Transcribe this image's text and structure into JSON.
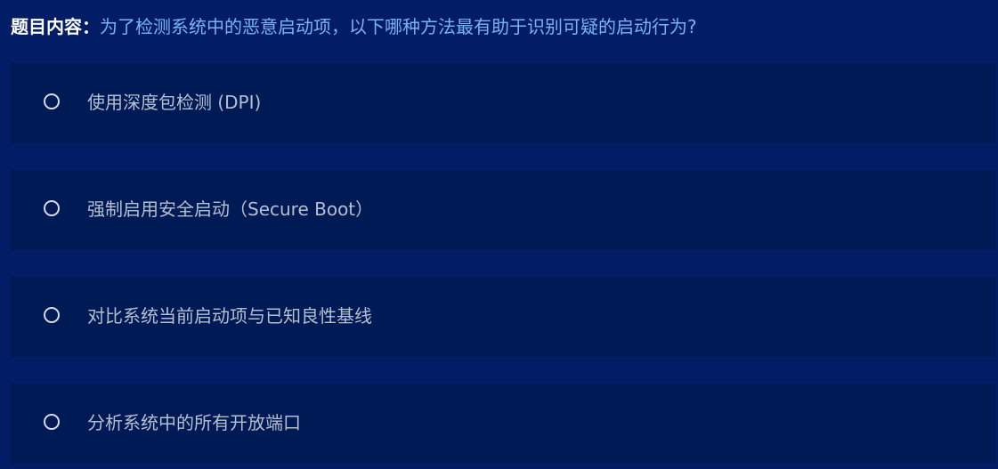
{
  "question": {
    "label": "题目内容：",
    "text": "为了检测系统中的恶意启动项，以下哪种方法最有助于识别可疑的启动行为?"
  },
  "options": [
    {
      "label": "使用深度包检测 (DPI)"
    },
    {
      "label": "强制启用安全启动（Secure Boot）"
    },
    {
      "label": "对比系统当前启动项与已知良性基线"
    },
    {
      "label": "分析系统中的所有开放端口"
    }
  ],
  "colors": {
    "background": "#021d66",
    "option_background": "#001a55",
    "question_text": "#7ab2f5",
    "option_text": "#b6bfd2"
  }
}
